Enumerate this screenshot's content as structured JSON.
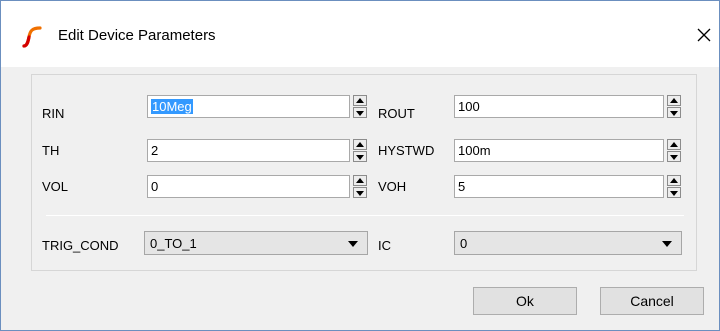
{
  "window": {
    "title": "Edit Device Parameters",
    "accent_color": "#ff6a00"
  },
  "params": {
    "rin": {
      "label": "RIN",
      "value_selected": "10Meg"
    },
    "rout": {
      "label": "ROUT",
      "value": "100"
    },
    "th": {
      "label": "TH",
      "value": "2"
    },
    "hystwd": {
      "label": "HYSTWD",
      "value": "100m"
    },
    "vol": {
      "label": "VOL",
      "value": "0"
    },
    "voh": {
      "label": "VOH",
      "value": "5"
    }
  },
  "selects": {
    "trig_cond": {
      "label": "TRIG_COND",
      "value": "0_TO_1"
    },
    "ic": {
      "label": "IC",
      "value": "0"
    }
  },
  "buttons": {
    "ok": "Ok",
    "cancel": "Cancel"
  },
  "icons": {
    "app": "ltspice-squiggle-icon",
    "close": "close-icon",
    "spin_up": "spin-up-arrow-icon",
    "spin_down": "spin-down-arrow-icon",
    "dropdown": "chevron-down-icon"
  }
}
